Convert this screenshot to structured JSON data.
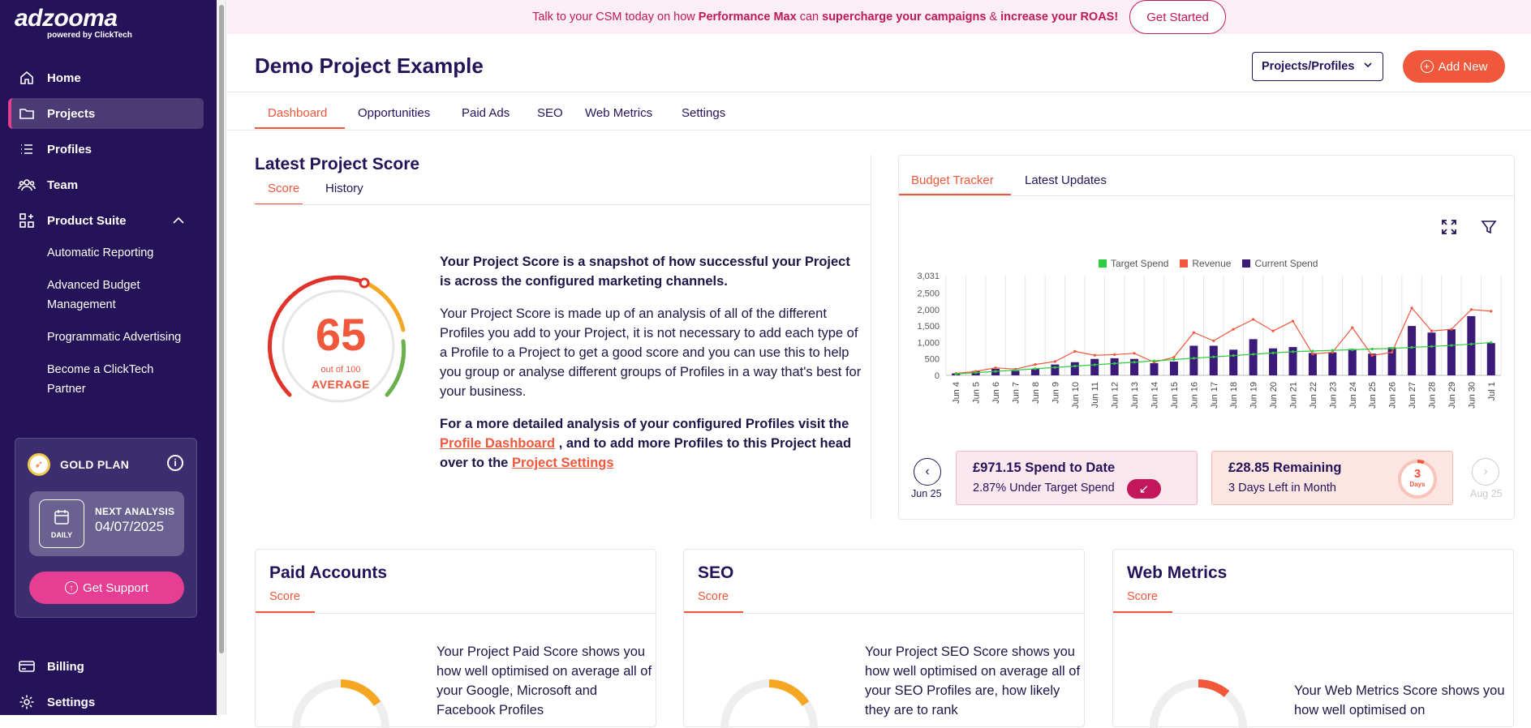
{
  "brand": {
    "name": "adzooma",
    "powered": "powered by ClickTech"
  },
  "sidebar": {
    "items": [
      {
        "label": "Home",
        "icon": "home-icon"
      },
      {
        "label": "Projects",
        "icon": "folder-icon"
      },
      {
        "label": "Profiles",
        "icon": "list-icon"
      },
      {
        "label": "Team",
        "icon": "team-icon"
      },
      {
        "label": "Product Suite",
        "icon": "grid-plus-icon"
      }
    ],
    "product_suite": [
      "Automatic Reporting",
      "Advanced Budget Management",
      "Programmatic Advertising",
      "Become a ClickTech Partner"
    ],
    "bottom": [
      {
        "label": "Billing",
        "icon": "billing-icon"
      },
      {
        "label": "Settings",
        "icon": "gear-icon"
      }
    ]
  },
  "plan": {
    "name": "GOLD PLAN",
    "next_label": "NEXT ANALYSIS",
    "next_date": "04/07/2025",
    "frequency": "DAILY",
    "support": "Get Support"
  },
  "banner": {
    "t1": "Talk to your CSM today on how ",
    "b1": "Performance Max",
    "t2": " can ",
    "b2": "supercharge your campaigns",
    "t3": " & ",
    "b3": "increase your ROAS!",
    "cta": "Get Started"
  },
  "header": {
    "title": "Demo Project Example",
    "select": "Projects/Profiles",
    "add_new": "Add New"
  },
  "tabs": [
    "Dashboard",
    "Opportunities",
    "Paid Ads",
    "SEO",
    "Web Metrics",
    "Settings"
  ],
  "score": {
    "title": "Latest Project Score",
    "tabs": [
      "Score",
      "History"
    ],
    "value": "65",
    "out_of": "out of 100",
    "rating": "AVERAGE",
    "p1": "Your Project Score is a snapshot of how successful your Project is across the configured marketing channels.",
    "p2": "Your Project Score is made up of an analysis of all of the different Profiles you add to your Project, it is not necessary to add each type of a Profile to a Project to get a good score and you can use this to help you group or analyse different groups of Profiles in a way that's best for your business.",
    "p3a": "For a more detailed analysis of your configured Profiles visit the ",
    "link1": "Profile Dashboard",
    "p3b": " , and to add more Profiles to this Project head over to the ",
    "link2": "Project Settings"
  },
  "budget": {
    "tabs": [
      "Budget Tracker",
      "Latest Updates"
    ],
    "prev_month": "Jun 25",
    "next_month": "Aug 25",
    "spend": "£971.15 Spend to Date",
    "under": "2.87% Under Target Spend",
    "remaining": "£28.85 Remaining",
    "days_left": "3 Days Left in Month",
    "days_num": "3",
    "days_lbl": "Days"
  },
  "chart_data": {
    "type": "bar",
    "categories": [
      "Jun 4",
      "Jun 5",
      "Jun 6",
      "Jun 7",
      "Jun 8",
      "Jun 9",
      "Jun 10",
      "Jun 11",
      "Jun 12",
      "Jun 13",
      "Jun 14",
      "Jun 15",
      "Jun 16",
      "Jun 17",
      "Jun 18",
      "Jun 19",
      "Jun 20",
      "Jun 21",
      "Jun 22",
      "Jun 23",
      "Jun 24",
      "Jun 25",
      "Jun 26",
      "Jun 27",
      "Jun 28",
      "Jun 29",
      "Jun 30",
      "Jul 1"
    ],
    "series": [
      {
        "name": "Current Spend",
        "kind": "bar",
        "color": "#3b1a7a",
        "values": [
          60,
          130,
          200,
          140,
          200,
          330,
          400,
          500,
          520,
          500,
          370,
          420,
          900,
          900,
          780,
          1100,
          820,
          860,
          680,
          700,
          800,
          660,
          850,
          1500,
          1300,
          1400,
          1800,
          980
        ]
      },
      {
        "name": "Revenue",
        "kind": "line",
        "color": "#f0573b",
        "values": [
          60,
          120,
          230,
          190,
          330,
          420,
          730,
          610,
          630,
          670,
          400,
          550,
          1300,
          1050,
          1400,
          1700,
          1350,
          1650,
          650,
          700,
          1450,
          600,
          700,
          2050,
          1350,
          1400,
          2000,
          1950
        ]
      },
      {
        "name": "Target Spend",
        "kind": "line",
        "color": "#2ecc40",
        "values": [
          40,
          80,
          120,
          160,
          200,
          240,
          280,
          320,
          360,
          400,
          440,
          480,
          520,
          560,
          600,
          640,
          680,
          720,
          740,
          760,
          780,
          800,
          820,
          850,
          880,
          910,
          950,
          1000
        ]
      }
    ],
    "yticks": [
      0,
      500,
      1000,
      1500,
      2000,
      2500,
      3031
    ],
    "ytick_labels": [
      "0",
      "500",
      "1,000",
      "1,500",
      "2,000",
      "2,500",
      "3,031"
    ],
    "ylim": [
      0,
      3031
    ],
    "legend": "top"
  },
  "cards": [
    {
      "title": "Paid Accounts",
      "sub": "Score",
      "text": "Your Project Paid Score shows you how well optimised on average all of your Google, Microsoft and Facebook Profiles",
      "gauge_color": "#f5a623"
    },
    {
      "title": "SEO",
      "sub": "Score",
      "text": "Your Project SEO Score shows you how well optimised on average all of your SEO Profiles are, how likely they are to rank",
      "gauge_color": "#f5a623"
    },
    {
      "title": "Web Metrics",
      "sub": "Score",
      "text": "Your Web Metrics Score shows you how well optimised on",
      "gauge_color": "#f0573b"
    }
  ]
}
